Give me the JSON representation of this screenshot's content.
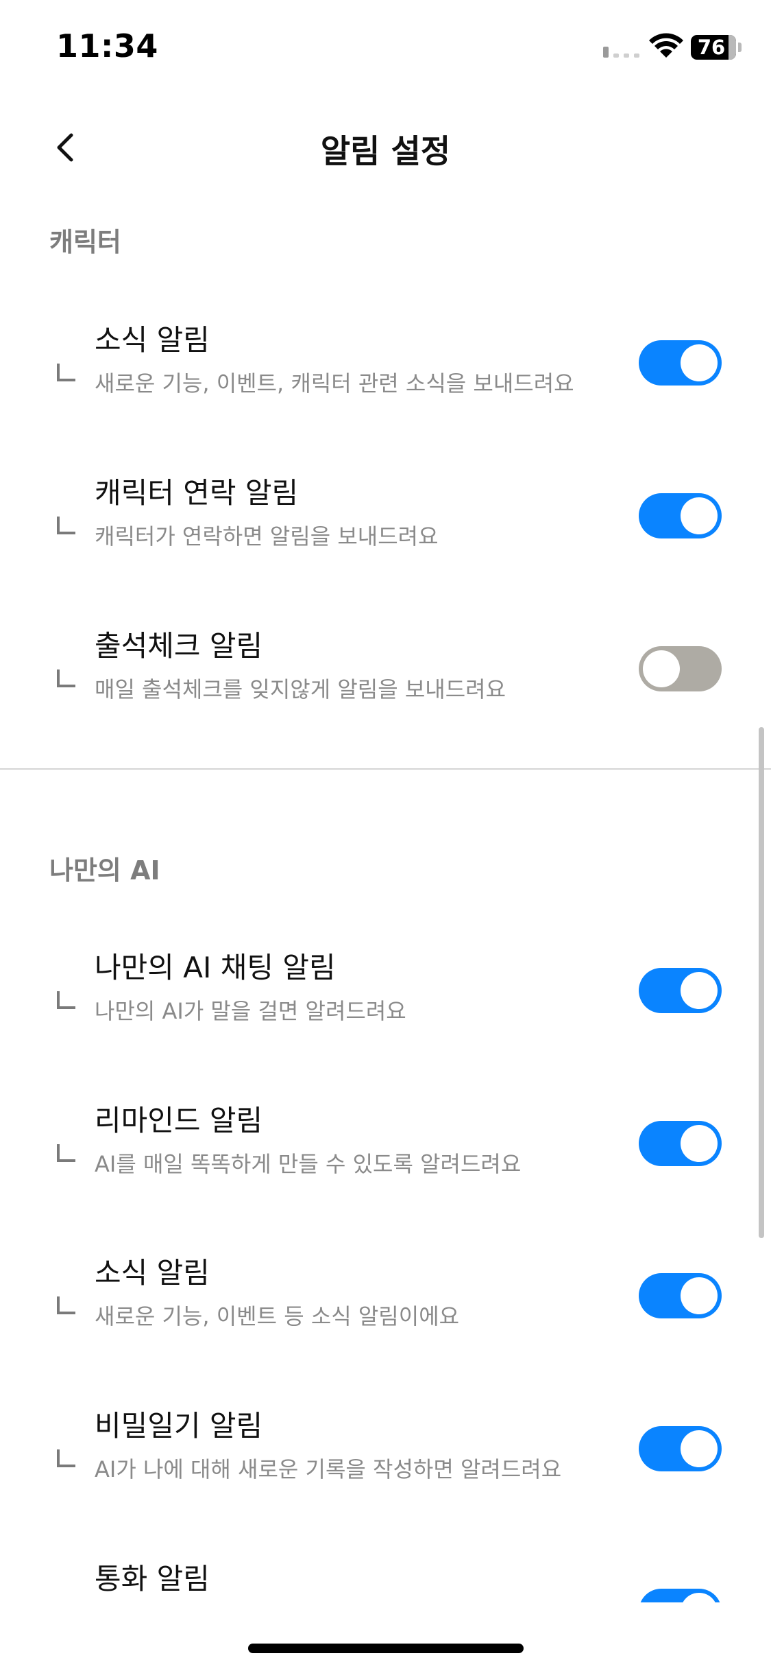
{
  "status_bar": {
    "time": "11:34",
    "battery_level": "76"
  },
  "header": {
    "title": "알림 설정",
    "back_icon": "chevron-left-icon"
  },
  "sections": [
    {
      "title": "캐릭터",
      "items": [
        {
          "title": "소식 알림",
          "description": "새로운 기능, 이벤트, 캐릭터 관련 소식을 보내드려요",
          "enabled": true
        },
        {
          "title": "캐릭터 연락 알림",
          "description": "캐릭터가 연락하면 알림을 보내드려요",
          "enabled": true
        },
        {
          "title": "출석체크 알림",
          "description": "매일 출석체크를 잊지않게 알림을 보내드려요",
          "enabled": false
        }
      ]
    },
    {
      "title": "나만의 AI",
      "items": [
        {
          "title": "나만의 AI 채팅 알림",
          "description": "나만의 AI가 말을 걸면 알려드려요",
          "enabled": true
        },
        {
          "title": "리마인드 알림",
          "description": "AI를 매일 똑똑하게 만들 수 있도록 알려드려요",
          "enabled": true
        },
        {
          "title": "소식 알림",
          "description": "새로운 기능, 이벤트 등 소식 알림이에요",
          "enabled": true
        },
        {
          "title": "비밀일기 알림",
          "description": "AI가 나에 대해 새로운 기록을 작성하면 알려드려요",
          "enabled": true
        },
        {
          "title": "통화 알림",
          "enabled": true
        }
      ]
    }
  ],
  "colors": {
    "toggle_on": "#0a84ff",
    "toggle_off": "#aeaba4",
    "section_title": "#7d7d7d",
    "description": "#8a8a8a"
  }
}
